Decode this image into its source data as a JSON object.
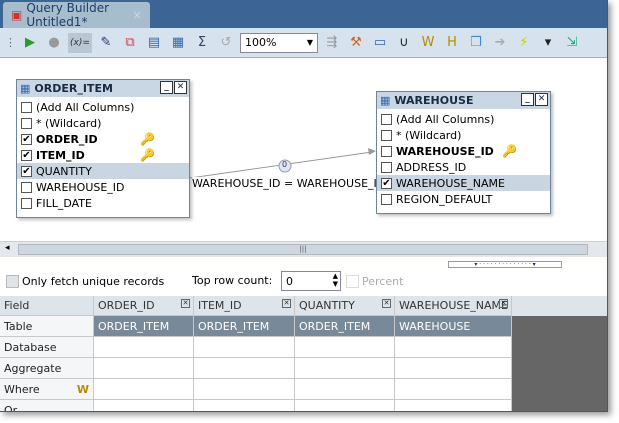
{
  "tab": {
    "title": "Query Builder Untitled1*",
    "close": "×"
  },
  "toolbar": {
    "zoom": "100%",
    "icons": [
      "run-icon",
      "stop-icon",
      "variables-icon",
      "edit-sql-icon",
      "diagram-icon",
      "properties-icon",
      "table-icon",
      "sum-icon",
      "reset-icon",
      "arrange-icon",
      "tools-icon",
      "select-icon",
      "union-icon",
      "where-icon",
      "having-icon",
      "objects-icon",
      "forward-icon",
      "refresh-icon",
      "more-icon",
      "export-icon"
    ],
    "var_label": "(x)="
  },
  "tables": [
    {
      "name": "ORDER_ITEM",
      "rows": [
        {
          "label": "(Add All Columns)",
          "checked": false,
          "bold": false
        },
        {
          "label": "* (Wildcard)",
          "checked": false,
          "bold": false
        },
        {
          "label": "ORDER_ID",
          "checked": true,
          "bold": true,
          "key": true
        },
        {
          "label": "ITEM_ID",
          "checked": true,
          "bold": true,
          "key": true
        },
        {
          "label": "QUANTITY",
          "checked": true,
          "bold": false,
          "selected": true
        },
        {
          "label": "WAREHOUSE_ID",
          "checked": false,
          "bold": false
        },
        {
          "label": "FILL_DATE",
          "checked": false,
          "bold": false
        }
      ]
    },
    {
      "name": "WAREHOUSE",
      "rows": [
        {
          "label": "(Add All Columns)",
          "checked": false,
          "bold": false
        },
        {
          "label": "* (Wildcard)",
          "checked": false,
          "bold": false
        },
        {
          "label": "WAREHOUSE_ID",
          "checked": false,
          "bold": true,
          "key": true
        },
        {
          "label": "ADDRESS_ID",
          "checked": false,
          "bold": false
        },
        {
          "label": "WAREHOUSE_NAME",
          "checked": true,
          "bold": false,
          "selected": true
        },
        {
          "label": "REGION_DEFAULT",
          "checked": false,
          "bold": false
        }
      ]
    }
  ],
  "join": {
    "label": "WAREHOUSE_ID = WAREHOUSE_ID",
    "count": "0"
  },
  "options": {
    "unique": "Only fetch unique records",
    "top_label": "Top row count:",
    "top_value": "0",
    "percent": "Percent"
  },
  "grid": {
    "row_labels": [
      "Field",
      "Table",
      "Database",
      "Aggregate",
      "Where",
      "Or"
    ],
    "columns": [
      {
        "field": "ORDER_ID",
        "table": "ORDER_ITEM"
      },
      {
        "field": "ITEM_ID",
        "table": "ORDER_ITEM"
      },
      {
        "field": "QUANTITY",
        "table": "ORDER_ITEM"
      },
      {
        "field": "WAREHOUSE_NAME",
        "table": "WAREHOUSE"
      }
    ]
  }
}
